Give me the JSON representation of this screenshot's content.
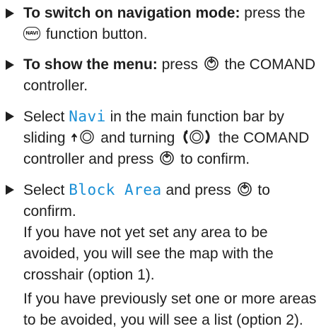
{
  "instructions": {
    "step1": {
      "label": "To switch on navigation mode:",
      "text_a": " press the",
      "key_icon_text": "NAVI",
      "text_b": " function button."
    },
    "step2": {
      "label": "To show the menu:",
      "text_a": " press",
      "text_b": " the COMAND controller."
    },
    "step3": {
      "text_a": "Select ",
      "display_item": "Navi",
      "text_b": " in the main function bar by sliding",
      "text_c": " and turning",
      "text_d": " the COMAND controller and press",
      "text_e": " to confirm."
    },
    "step4": {
      "text_a": "Select ",
      "display_item": "Block Area",
      "text_b": " and press",
      "text_c": " to confirm.",
      "note_1": "If you have not yet set any area to be avoided, you will see the map with the crosshair (option 1).",
      "note_2": "If you have previously set one or more areas to be avoided, you will see a list (option 2)."
    }
  },
  "icons": {
    "bullet": "triangle-bullet-icon",
    "navi_button": "navi-function-button-icon",
    "press": "press-controller-icon",
    "slide_up": "slide-up-controller-icon",
    "turn": "turn-controller-icon"
  },
  "colors": {
    "text": "#1f1f1f",
    "display_text": "#1a8fd6",
    "background": "#ffffff"
  }
}
